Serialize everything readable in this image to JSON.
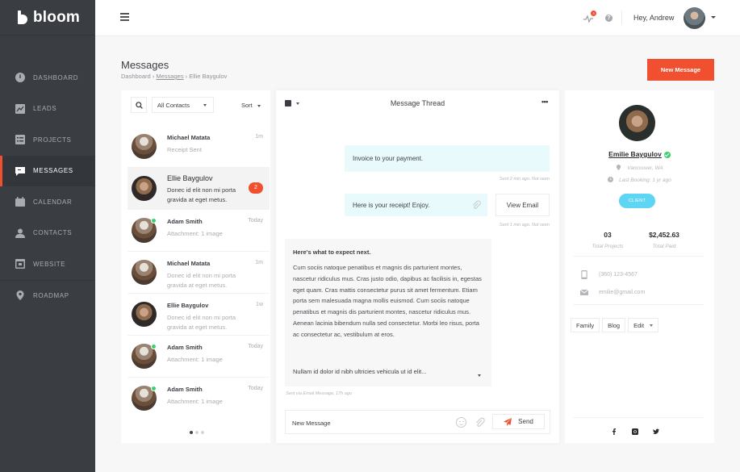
{
  "app": {
    "brand": "bloom"
  },
  "sidebar": {
    "items": [
      {
        "label": "DASHBOARD",
        "icon": "dashboard-icon",
        "active": false
      },
      {
        "label": "LEADS",
        "icon": "leads-chart-icon",
        "active": false
      },
      {
        "label": "PROJECTS",
        "icon": "projects-list-icon",
        "active": false
      },
      {
        "label": "MESSAGES",
        "icon": "chat-bubble-icon",
        "active": true
      },
      {
        "label": "CALENDAR",
        "icon": "calendar-icon",
        "active": false
      },
      {
        "label": "CONTACTS",
        "icon": "person-icon",
        "active": false
      },
      {
        "label": "WEBSITE",
        "icon": "browser-window-icon",
        "active": false
      },
      {
        "label": "ROADMAP",
        "icon": "map-pin-icon",
        "active": false
      }
    ]
  },
  "topbar": {
    "notification_count": "3",
    "help_glyph": "?",
    "greeting": "Hey, Andrew"
  },
  "page": {
    "title": "Messages",
    "breadcrumb": [
      "Dashboard",
      "Messages",
      "Ellie Baygulov"
    ],
    "breadcrumb_sep": "›",
    "new_message_label": "New Message"
  },
  "contact_list": {
    "filter_value": "All Contacts",
    "sort_label": "Sort",
    "contacts": [
      {
        "name": "Michael Matata",
        "time": "1m",
        "preview": "Receipt Sent",
        "online": false,
        "unread": null,
        "active": false
      },
      {
        "name": "Ellie Baygulov",
        "time": "",
        "preview": "Donec id elit non mi porta gravida at eget metus.",
        "online": false,
        "unread": "2",
        "active": true
      },
      {
        "name": "Adam Smith",
        "time": "Today",
        "preview": "Attachment: 1 image",
        "online": true,
        "unread": null,
        "active": false
      },
      {
        "name": "Michael Matata",
        "time": "1m",
        "preview": "Donec id elit non mi porta gravida at eget metus.",
        "online": false,
        "unread": null,
        "active": false
      },
      {
        "name": "Ellie Baygulov",
        "time": "1w",
        "preview": "Donec id elit non mi porta gravida at eget metus.",
        "online": false,
        "unread": null,
        "active": false
      },
      {
        "name": "Adam Smith",
        "time": "Today",
        "preview": "Attachment: 1 image",
        "online": true,
        "unread": null,
        "active": false
      },
      {
        "name": "Adam Smith",
        "time": "Today",
        "preview": "Attachment: 1 image",
        "online": true,
        "unread": null,
        "active": false
      }
    ],
    "pages": 3,
    "current_page": 1
  },
  "thread": {
    "title": "Message Thread",
    "more_glyph": "•••",
    "messages": [
      {
        "text": "Invoice to your payment.",
        "meta": "Sent 2 min ago. Not seen"
      },
      {
        "text": "Here is your receipt! Enjoy.",
        "meta": "Sent 1 min ago. Not seen",
        "action": "View Email"
      }
    ],
    "incoming": {
      "heading": "Here's what to expect next.",
      "body": "Cum sociis natoque penatibus et magnis dis parturient montes, nascetur ridiculus mus. Cras justo odio, dapibus ac facilisis in, egestas eget quam. Cras mattis consectetur purus sit amet fermentum. Etiam porta sem malesuada magna mollis euismod. Cum sociis natoque penatibus et magnis dis parturient montes, nascetur ridiculus mus. Aenean lacinia bibendum nulla sed consectetur. Morbi leo risus, porta ac consectetur ac, vestibulum at eros.",
      "more": "Nullam id dolor id nibh ultricies vehicula ut id elit...",
      "meta": "Sent via Email Message, 17h ago"
    },
    "compose_placeholder": "New Message",
    "send_label": "Send"
  },
  "profile": {
    "name": "Emilie Baygulov",
    "verified": true,
    "location": "Vancouver, WA",
    "last_booking": "Last Booking: 1 yr ago",
    "tag": "CLIENT",
    "stats": [
      {
        "value": "03",
        "label": "Total Projects"
      },
      {
        "value": "$2,452.63",
        "label": "Total Paid"
      }
    ],
    "phone": "(360) 123-4567",
    "email": "emilie@gmail.com",
    "chips": [
      "Family",
      "Blog",
      "Edit"
    ],
    "socials": [
      "facebook",
      "instagram",
      "twitter"
    ]
  },
  "colors": {
    "accent": "#f0502f",
    "sidebar_bg": "#3a3d42",
    "outgoing_bubble": "#e9fafd",
    "client_tag": "#5ed5f3",
    "online": "#3ecf6e"
  }
}
